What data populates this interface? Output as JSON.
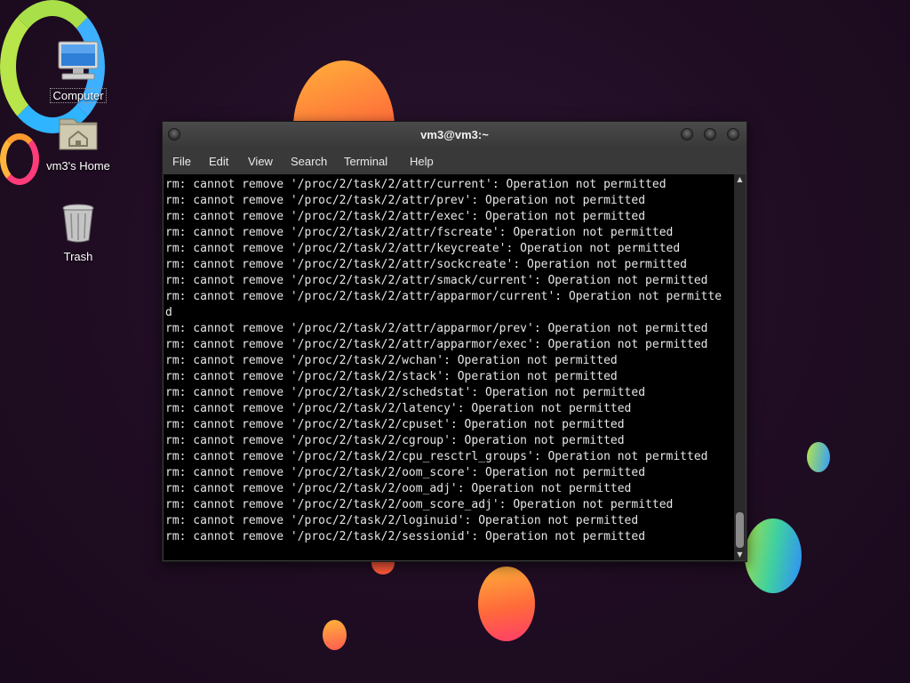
{
  "desktop": {
    "icons": [
      {
        "label": "Computer",
        "icon": "computer-icon"
      },
      {
        "label": "vm3's Home",
        "icon": "home-folder-icon"
      },
      {
        "label": "Trash",
        "icon": "trash-icon"
      }
    ]
  },
  "terminal": {
    "title": "vm3@vm3:~",
    "menu": [
      "File",
      "Edit",
      "View",
      "Search",
      "Terminal",
      "Help"
    ],
    "lines": [
      "rm: cannot remove '/proc/2/task/2/attr/current': Operation not permitted",
      "rm: cannot remove '/proc/2/task/2/attr/prev': Operation not permitted",
      "rm: cannot remove '/proc/2/task/2/attr/exec': Operation not permitted",
      "rm: cannot remove '/proc/2/task/2/attr/fscreate': Operation not permitted",
      "rm: cannot remove '/proc/2/task/2/attr/keycreate': Operation not permitted",
      "rm: cannot remove '/proc/2/task/2/attr/sockcreate': Operation not permitted",
      "rm: cannot remove '/proc/2/task/2/attr/smack/current': Operation not permitted",
      "rm: cannot remove '/proc/2/task/2/attr/apparmor/current': Operation not permitte",
      "d",
      "rm: cannot remove '/proc/2/task/2/attr/apparmor/prev': Operation not permitted",
      "rm: cannot remove '/proc/2/task/2/attr/apparmor/exec': Operation not permitted",
      "rm: cannot remove '/proc/2/task/2/wchan': Operation not permitted",
      "rm: cannot remove '/proc/2/task/2/stack': Operation not permitted",
      "rm: cannot remove '/proc/2/task/2/schedstat': Operation not permitted",
      "rm: cannot remove '/proc/2/task/2/latency': Operation not permitted",
      "rm: cannot remove '/proc/2/task/2/cpuset': Operation not permitted",
      "rm: cannot remove '/proc/2/task/2/cgroup': Operation not permitted",
      "rm: cannot remove '/proc/2/task/2/cpu_resctrl_groups': Operation not permitted",
      "rm: cannot remove '/proc/2/task/2/oom_score': Operation not permitted",
      "rm: cannot remove '/proc/2/task/2/oom_adj': Operation not permitted",
      "rm: cannot remove '/proc/2/task/2/oom_score_adj': Operation not permitted",
      "rm: cannot remove '/proc/2/task/2/loginuid': Operation not permitted",
      "rm: cannot remove '/proc/2/task/2/sessionid': Operation not permitted"
    ]
  },
  "colors": {
    "terminal_bg": "#000000",
    "terminal_fg": "#e6e6e6",
    "titlebar": "#3f3f3f",
    "desktop_bg": "#220f24"
  }
}
